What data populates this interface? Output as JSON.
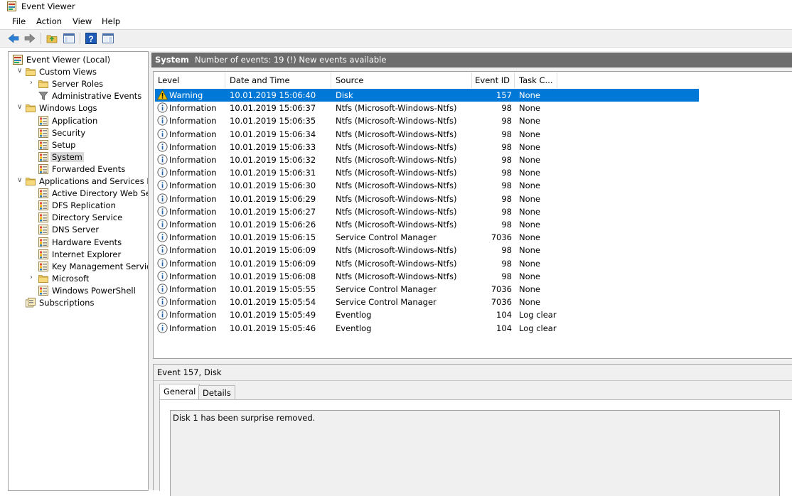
{
  "window": {
    "title": "Event Viewer"
  },
  "menu": [
    "File",
    "Action",
    "View",
    "Help"
  ],
  "toolbar": [
    "back-icon",
    "forward-icon",
    "up-folder-icon",
    "show-hide-tree-icon",
    "help-icon",
    "properties-icon"
  ],
  "tree": [
    {
      "label": "Event Viewer (Local)",
      "icon": "event-viewer-icon",
      "level": 0,
      "expander": ""
    },
    {
      "label": "Custom Views",
      "icon": "folder-icon",
      "level": 1,
      "expander": "open"
    },
    {
      "label": "Server Roles",
      "icon": "folder-icon",
      "level": 2,
      "expander": "closed"
    },
    {
      "label": "Administrative Events",
      "icon": "filter-icon",
      "level": 2,
      "expander": ""
    },
    {
      "label": "Windows Logs",
      "icon": "folder-icon",
      "level": 1,
      "expander": "open"
    },
    {
      "label": "Application",
      "icon": "log-icon",
      "level": 2,
      "expander": ""
    },
    {
      "label": "Security",
      "icon": "log-icon",
      "level": 2,
      "expander": ""
    },
    {
      "label": "Setup",
      "icon": "log-icon",
      "level": 2,
      "expander": ""
    },
    {
      "label": "System",
      "icon": "log-icon",
      "level": 2,
      "expander": "",
      "selected": true
    },
    {
      "label": "Forwarded Events",
      "icon": "log-icon",
      "level": 2,
      "expander": ""
    },
    {
      "label": "Applications and Services Lo",
      "icon": "folder-icon",
      "level": 1,
      "expander": "open"
    },
    {
      "label": "Active Directory Web Ser",
      "icon": "log-icon",
      "level": 2,
      "expander": ""
    },
    {
      "label": "DFS Replication",
      "icon": "log-icon",
      "level": 2,
      "expander": ""
    },
    {
      "label": "Directory Service",
      "icon": "log-icon",
      "level": 2,
      "expander": ""
    },
    {
      "label": "DNS Server",
      "icon": "log-icon",
      "level": 2,
      "expander": ""
    },
    {
      "label": "Hardware Events",
      "icon": "log-icon",
      "level": 2,
      "expander": ""
    },
    {
      "label": "Internet Explorer",
      "icon": "log-icon",
      "level": 2,
      "expander": ""
    },
    {
      "label": "Key Management Service",
      "icon": "log-icon",
      "level": 2,
      "expander": ""
    },
    {
      "label": "Microsoft",
      "icon": "folder-icon",
      "level": 2,
      "expander": "closed"
    },
    {
      "label": "Windows PowerShell",
      "icon": "log-icon",
      "level": 2,
      "expander": ""
    },
    {
      "label": "Subscriptions",
      "icon": "subscriptions-icon",
      "level": 1,
      "expander": ""
    }
  ],
  "log_header": {
    "name": "System",
    "info": "Number of events: 19 (!) New events available"
  },
  "columns": [
    "Level",
    "Date and Time",
    "Source",
    "Event ID",
    "Task C..."
  ],
  "events": [
    {
      "level": "Warning",
      "datetime": "10.01.2019 15:06:40",
      "source": "Disk",
      "event_id": "157",
      "task": "None",
      "selected": true
    },
    {
      "level": "Information",
      "datetime": "10.01.2019 15:06:37",
      "source": "Ntfs (Microsoft-Windows-Ntfs)",
      "event_id": "98",
      "task": "None"
    },
    {
      "level": "Information",
      "datetime": "10.01.2019 15:06:35",
      "source": "Ntfs (Microsoft-Windows-Ntfs)",
      "event_id": "98",
      "task": "None"
    },
    {
      "level": "Information",
      "datetime": "10.01.2019 15:06:34",
      "source": "Ntfs (Microsoft-Windows-Ntfs)",
      "event_id": "98",
      "task": "None"
    },
    {
      "level": "Information",
      "datetime": "10.01.2019 15:06:33",
      "source": "Ntfs (Microsoft-Windows-Ntfs)",
      "event_id": "98",
      "task": "None"
    },
    {
      "level": "Information",
      "datetime": "10.01.2019 15:06:32",
      "source": "Ntfs (Microsoft-Windows-Ntfs)",
      "event_id": "98",
      "task": "None"
    },
    {
      "level": "Information",
      "datetime": "10.01.2019 15:06:31",
      "source": "Ntfs (Microsoft-Windows-Ntfs)",
      "event_id": "98",
      "task": "None"
    },
    {
      "level": "Information",
      "datetime": "10.01.2019 15:06:30",
      "source": "Ntfs (Microsoft-Windows-Ntfs)",
      "event_id": "98",
      "task": "None"
    },
    {
      "level": "Information",
      "datetime": "10.01.2019 15:06:29",
      "source": "Ntfs (Microsoft-Windows-Ntfs)",
      "event_id": "98",
      "task": "None"
    },
    {
      "level": "Information",
      "datetime": "10.01.2019 15:06:27",
      "source": "Ntfs (Microsoft-Windows-Ntfs)",
      "event_id": "98",
      "task": "None"
    },
    {
      "level": "Information",
      "datetime": "10.01.2019 15:06:26",
      "source": "Ntfs (Microsoft-Windows-Ntfs)",
      "event_id": "98",
      "task": "None"
    },
    {
      "level": "Information",
      "datetime": "10.01.2019 15:06:15",
      "source": "Service Control Manager",
      "event_id": "7036",
      "task": "None"
    },
    {
      "level": "Information",
      "datetime": "10.01.2019 15:06:09",
      "source": "Ntfs (Microsoft-Windows-Ntfs)",
      "event_id": "98",
      "task": "None"
    },
    {
      "level": "Information",
      "datetime": "10.01.2019 15:06:09",
      "source": "Ntfs (Microsoft-Windows-Ntfs)",
      "event_id": "98",
      "task": "None"
    },
    {
      "level": "Information",
      "datetime": "10.01.2019 15:06:08",
      "source": "Ntfs (Microsoft-Windows-Ntfs)",
      "event_id": "98",
      "task": "None"
    },
    {
      "level": "Information",
      "datetime": "10.01.2019 15:05:55",
      "source": "Service Control Manager",
      "event_id": "7036",
      "task": "None"
    },
    {
      "level": "Information",
      "datetime": "10.01.2019 15:05:54",
      "source": "Service Control Manager",
      "event_id": "7036",
      "task": "None"
    },
    {
      "level": "Information",
      "datetime": "10.01.2019 15:05:49",
      "source": "Eventlog",
      "event_id": "104",
      "task": "Log clear"
    },
    {
      "level": "Information",
      "datetime": "10.01.2019 15:05:46",
      "source": "Eventlog",
      "event_id": "104",
      "task": "Log clear"
    }
  ],
  "detail": {
    "title": "Event 157, Disk",
    "tabs": [
      {
        "label": "General",
        "active": true
      },
      {
        "label": "Details",
        "active": false
      }
    ],
    "description": "Disk 1 has been surprise removed."
  },
  "colors": {
    "selection": "#0078d7",
    "header_band": "#6d6d6d",
    "warning": "#f3c200",
    "info_blue": "#1f5fa8"
  }
}
